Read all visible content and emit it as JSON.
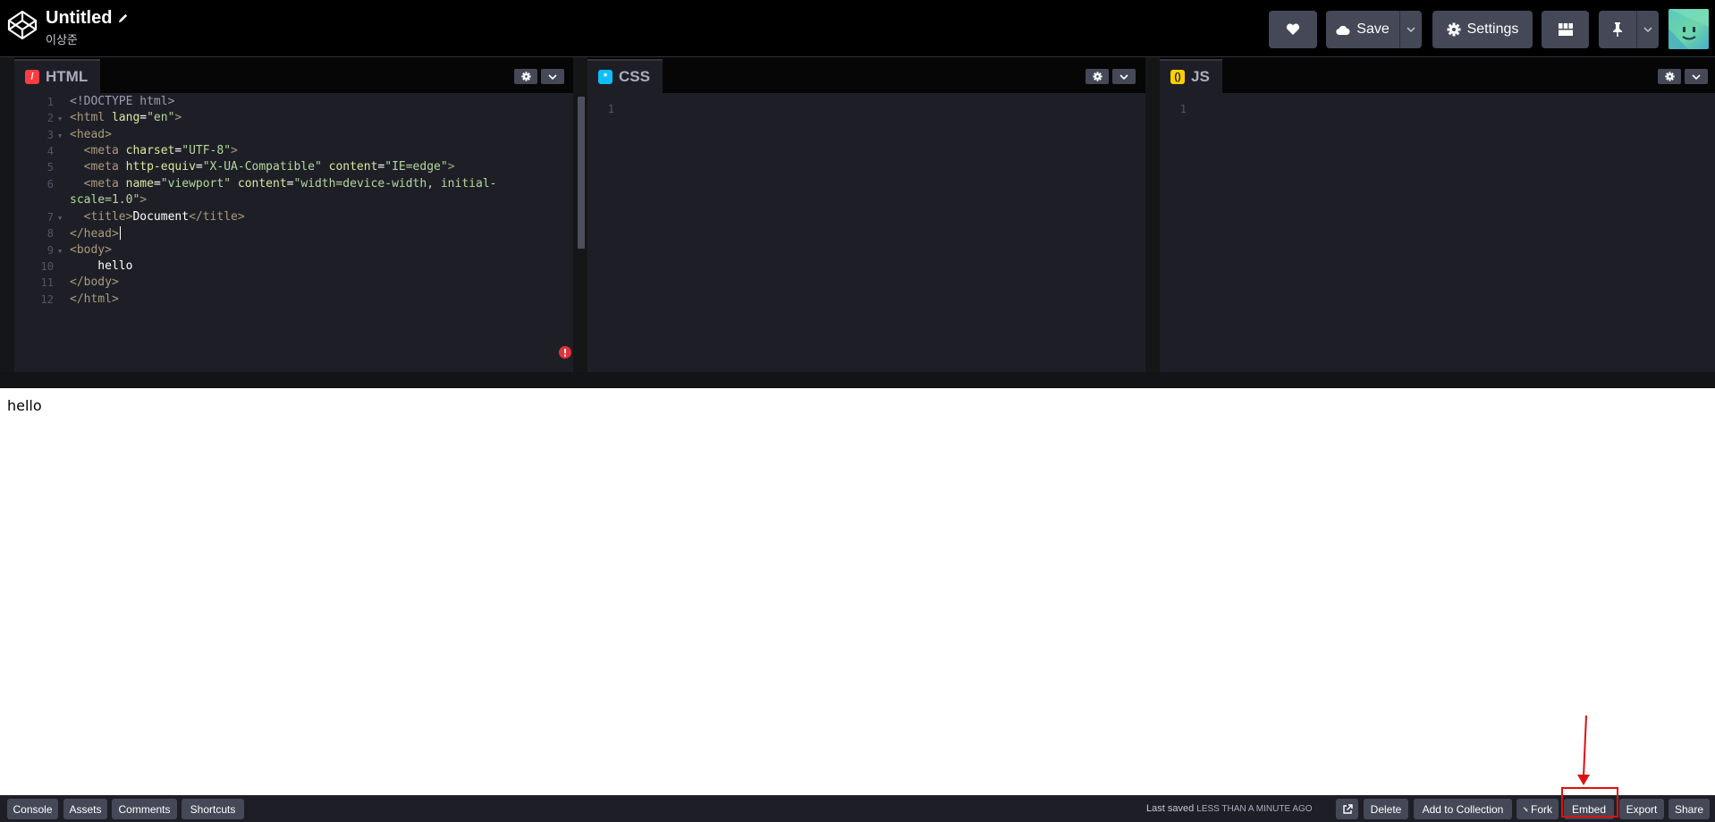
{
  "header": {
    "pen_title": "Untitled",
    "author": "이상준",
    "save_label": "Save",
    "settings_label": "Settings"
  },
  "editors": {
    "html": {
      "tab_label": "HTML",
      "lines": [
        "1",
        "2",
        "3",
        "4",
        "5",
        "6",
        "",
        "7",
        "8",
        "9",
        "10",
        "11",
        "12"
      ],
      "code": {
        "l1": "<!DOCTYPE html>",
        "l2_tag": "<html ",
        "l2_attr": "lang",
        "l2_eq": "=",
        "l2_val": "\"en\"",
        "l2_end": ">",
        "l3": "<head>",
        "l4_tag": "  <meta ",
        "l4_attr": "charset",
        "l4_val": "\"UTF-8\"",
        "l4_end": ">",
        "l5_tag": "  <meta ",
        "l5_attr1": "http-equiv",
        "l5_val1": "\"X-UA-Compatible\"",
        "l5_attr2": " content",
        "l5_val2": "\"IE=edge\"",
        "l5_end": ">",
        "l6_tag": "  <meta ",
        "l6_attr1": "name",
        "l6_val1": "\"viewport\"",
        "l6_attr2": " content",
        "l6_val2a": "\"width=device-width, initial-",
        "l6_val2b": "scale=1.0\"",
        "l6_end": ">",
        "l7_open": "  <title>",
        "l7_text": "Document",
        "l7_close": "</title>",
        "l8": "</head>",
        "l9": "<body>",
        "l10": "    hello",
        "l11": "</body>",
        "l12": "</html>"
      }
    },
    "css": {
      "tab_label": "CSS",
      "line1": "1"
    },
    "js": {
      "tab_label": "JS",
      "line1": "1"
    }
  },
  "preview": {
    "text": "hello"
  },
  "footer": {
    "console": "Console",
    "assets": "Assets",
    "comments": "Comments",
    "shortcuts": "Shortcuts",
    "last_saved_prefix": "Last saved ",
    "last_saved_when": "LESS THAN A MINUTE AGO",
    "delete": "Delete",
    "add_to_collection": "Add to Collection",
    "fork": "Fork",
    "embed": "Embed",
    "export": "Export",
    "share": "Share"
  },
  "colors": {
    "html_icon": "#ff3c41",
    "css_icon": "#0ebeff",
    "js_icon": "#fcd000",
    "annotation_red": "#e01010"
  }
}
